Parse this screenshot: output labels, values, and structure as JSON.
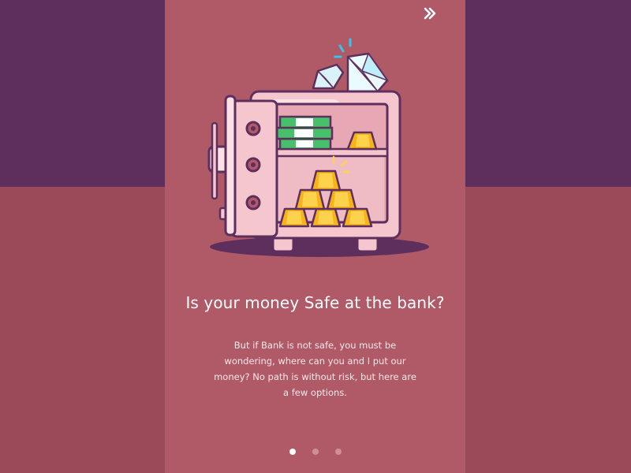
{
  "onboarding": {
    "title": "Is your money Safe at the bank?",
    "description": "But if Bank is not safe, you must be wondering, where can you and I put our money? No path is without risk, but here are a few options.",
    "skip_icon": "double-chevron-right-icon",
    "illustration": "bank-safe-with-gold-cash-diamonds",
    "pagination": {
      "total": 3,
      "active_index": 0
    }
  },
  "colors": {
    "background_top": "#5e2f5c",
    "background_bottom": "#9b4a5a",
    "card": "#b05a68",
    "text": "#ffffff",
    "dot_active": "#ffffff",
    "dot_inactive": "#cf8e9a"
  }
}
